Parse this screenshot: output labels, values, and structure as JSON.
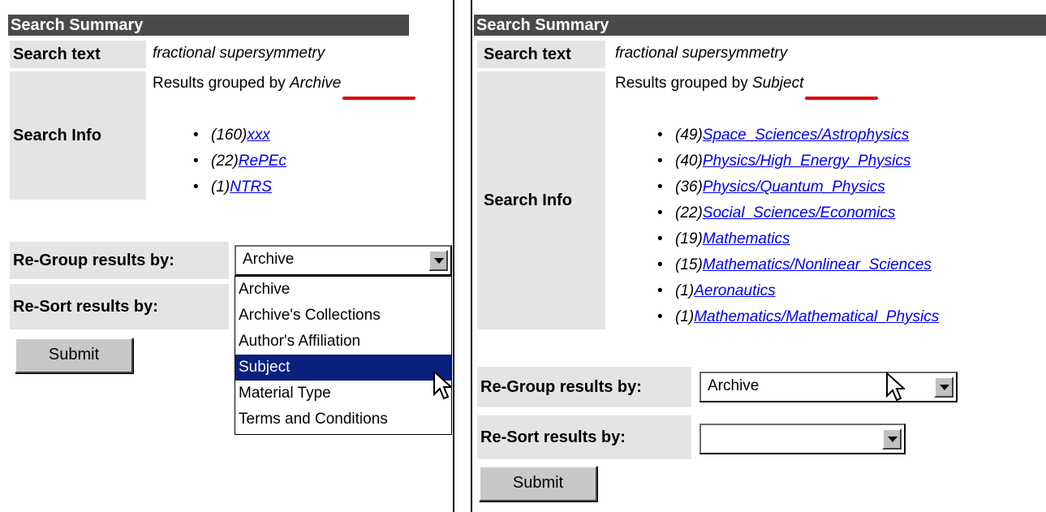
{
  "left": {
    "header": "Search Summary",
    "search_text_label": "Search text",
    "search_text_value": "fractional supersymmetry",
    "grouped_by_prefix": "Results grouped by",
    "grouped_by_value": "Archive",
    "search_info_label": "Search Info",
    "results": [
      {
        "count": "(160)",
        "link": "xxx"
      },
      {
        "count": "(22)",
        "link": "RePEc"
      },
      {
        "count": "(1)",
        "link": "NTRS"
      }
    ],
    "regroup_label": "Re-Group results by:",
    "regroup_value": "Archive",
    "resort_label": "Re-Sort results by:",
    "submit_label": "Submit",
    "dropdown_options": [
      "Archive",
      "Archive's Collections",
      "Author's Affiliation",
      "Subject",
      "Material Type",
      "Terms and Conditions"
    ],
    "dropdown_selected": "Subject"
  },
  "right": {
    "header": "Search Summary",
    "search_text_label": "Search text",
    "search_text_value": "fractional supersymmetry",
    "grouped_by_prefix": "Results grouped by",
    "grouped_by_value": "Subject",
    "search_info_label": "Search Info",
    "results": [
      {
        "count": "(49)",
        "link": "Space_Sciences/Astrophysics"
      },
      {
        "count": "(40)",
        "link": "Physics/High_Energy_Physics"
      },
      {
        "count": "(36)",
        "link": "Physics/Quantum_Physics"
      },
      {
        "count": "(22)",
        "link": "Social_Sciences/Economics"
      },
      {
        "count": "(19)",
        "link": "Mathematics"
      },
      {
        "count": "(15)",
        "link": "Mathematics/Nonlinear_Sciences"
      },
      {
        "count": "(1)",
        "link": "Aeronautics"
      },
      {
        "count": "(1)",
        "link": "Mathematics/Mathematical_Physics"
      }
    ],
    "regroup_label": "Re-Group results by:",
    "regroup_value": "Archive",
    "resort_label": "Re-Sort results by:",
    "resort_value": "",
    "submit_label": "Submit"
  },
  "colors": {
    "header_bg": "#4a4a4a",
    "label_bg": "#e4e4e4",
    "link": "#0000ee",
    "highlight": "#0a1f7e",
    "red_annotation": "#e00000"
  }
}
